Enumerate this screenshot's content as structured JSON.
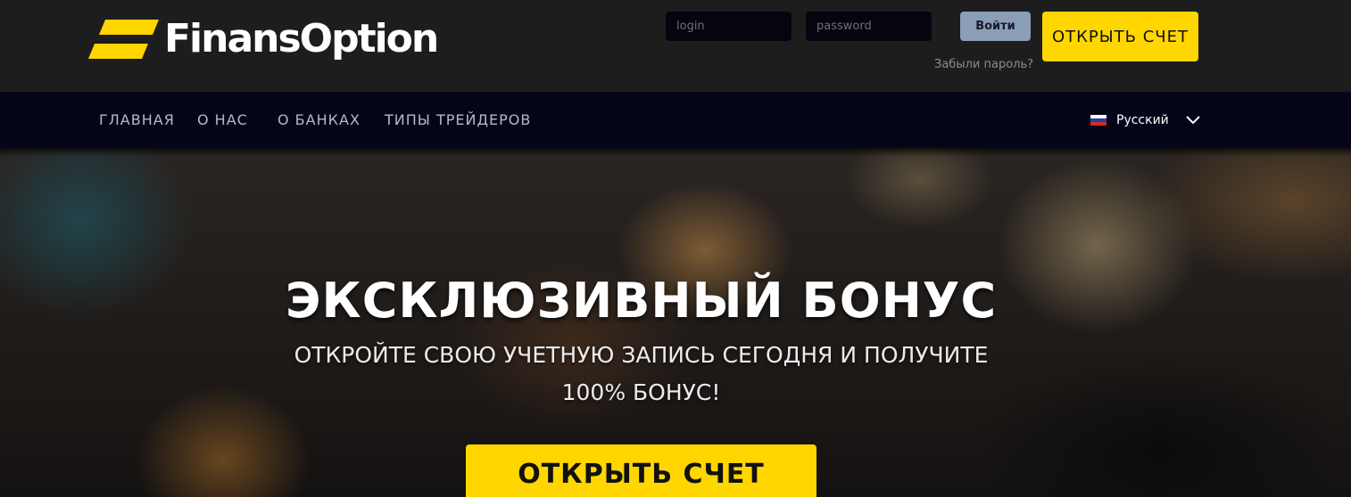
{
  "brand": {
    "name": "FinansOption",
    "accent": "#ffd600"
  },
  "login": {
    "login_placeholder": "login",
    "password_placeholder": "password",
    "submit_label": "Войти",
    "forgot_label": "Забыли пароль?",
    "open_account_label": "ОТКРЫТЬ СЧЕТ"
  },
  "nav": {
    "items": [
      {
        "label": "ГЛАВНАЯ"
      },
      {
        "label": "О НАС"
      },
      {
        "label": "О БАНКАХ"
      },
      {
        "label": "ТИПЫ ТРЕЙДЕРОВ"
      }
    ],
    "language": {
      "label": "Русский",
      "flag_icon": "russia-flag-icon"
    }
  },
  "hero": {
    "title": "ЭКСКЛЮЗИВНЫЙ БОНУС",
    "subtitle_line1": "ОТКРОЙТЕ СВОЮ УЧЕТНУЮ ЗАПИСЬ СЕГОДНЯ И ПОЛУЧИТЕ",
    "subtitle_line2": "100% БОНУС!",
    "cta_label": "ОТКРЫТЬ СЧЕТ"
  }
}
